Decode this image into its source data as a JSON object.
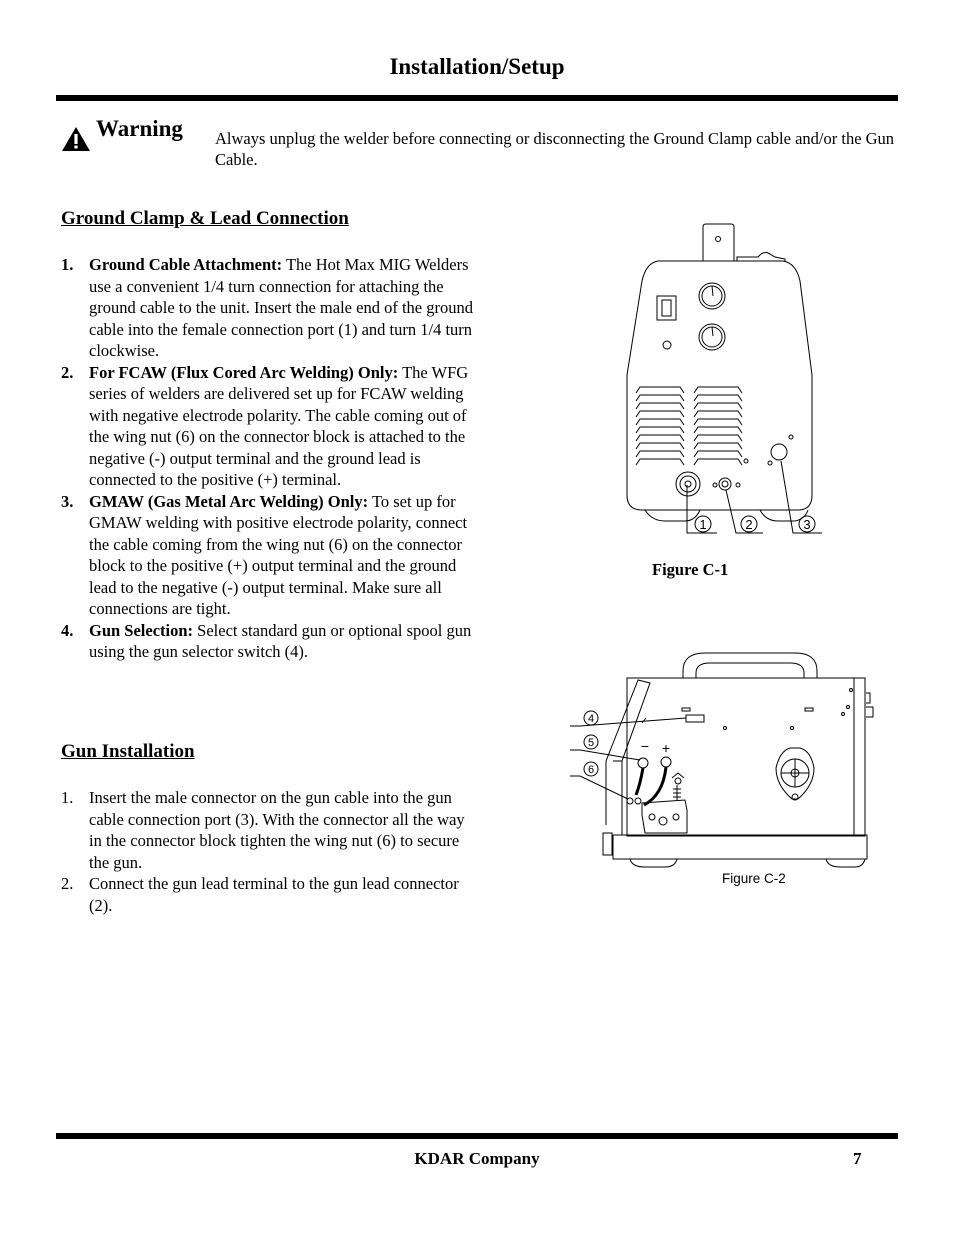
{
  "header": {
    "title": "Installation/Setup"
  },
  "warning": {
    "icon": "warning-triangle-icon",
    "label": "Warning",
    "text": "Always unplug the welder before connecting or disconnecting the Ground Clamp cable and/or the Gun Cable."
  },
  "ground_clamp": {
    "heading": "Ground Clamp & Lead Connection",
    "items": [
      {
        "num": "1.",
        "lead": "Ground Cable Attachment:",
        "text": " The Hot Max MIG Welders use a convenient 1/4 turn connection for attaching the ground cable to the unit. Insert the male end of the ground cable into the female connection port (1) and turn 1/4 turn clockwise."
      },
      {
        "num": "2.",
        "lead": "For FCAW (Flux Cored Arc Welding) Only:",
        "text": " The WFG series of welders are delivered set up for FCAW welding with negative electrode polarity. The cable coming out of the wing nut (6) on the connector block is attached to the negative (-) output terminal and the ground lead is connected to the positive (+) terminal."
      },
      {
        "num": "3.",
        "lead": "GMAW (Gas Metal Arc Welding) Only:",
        "text": " To set up for GMAW welding with positive electrode polarity, connect the cable coming from the wing nut (6) on the connector block to the positive (+) output terminal and the ground lead to the negative (-) output terminal. Make sure all connections are tight."
      },
      {
        "num": "4.",
        "lead": "Gun Selection:",
        "text": " Select standard gun or optional spool gun using the gun selector switch (4)."
      }
    ]
  },
  "gun_installation": {
    "heading": "Gun Installation",
    "items": [
      {
        "num": "1.",
        "text": "Insert the male connector on the gun cable into the gun cable connection port (3). With the connector all the way in the connector block tighten the wing nut (6) to secure the gun."
      },
      {
        "num": "2.",
        "text": "Connect the gun lead terminal to the gun lead connector (2)."
      }
    ]
  },
  "figure_c1": {
    "caption": "Figure C-1",
    "callouts": [
      "1",
      "2",
      "3"
    ]
  },
  "figure_c2": {
    "caption": "Figure C-2",
    "callouts": [
      "4",
      "5",
      "6"
    ],
    "polarity_minus": "−",
    "polarity_plus": "+"
  },
  "footer": {
    "company": "KDAR Company",
    "page_number": "7"
  }
}
